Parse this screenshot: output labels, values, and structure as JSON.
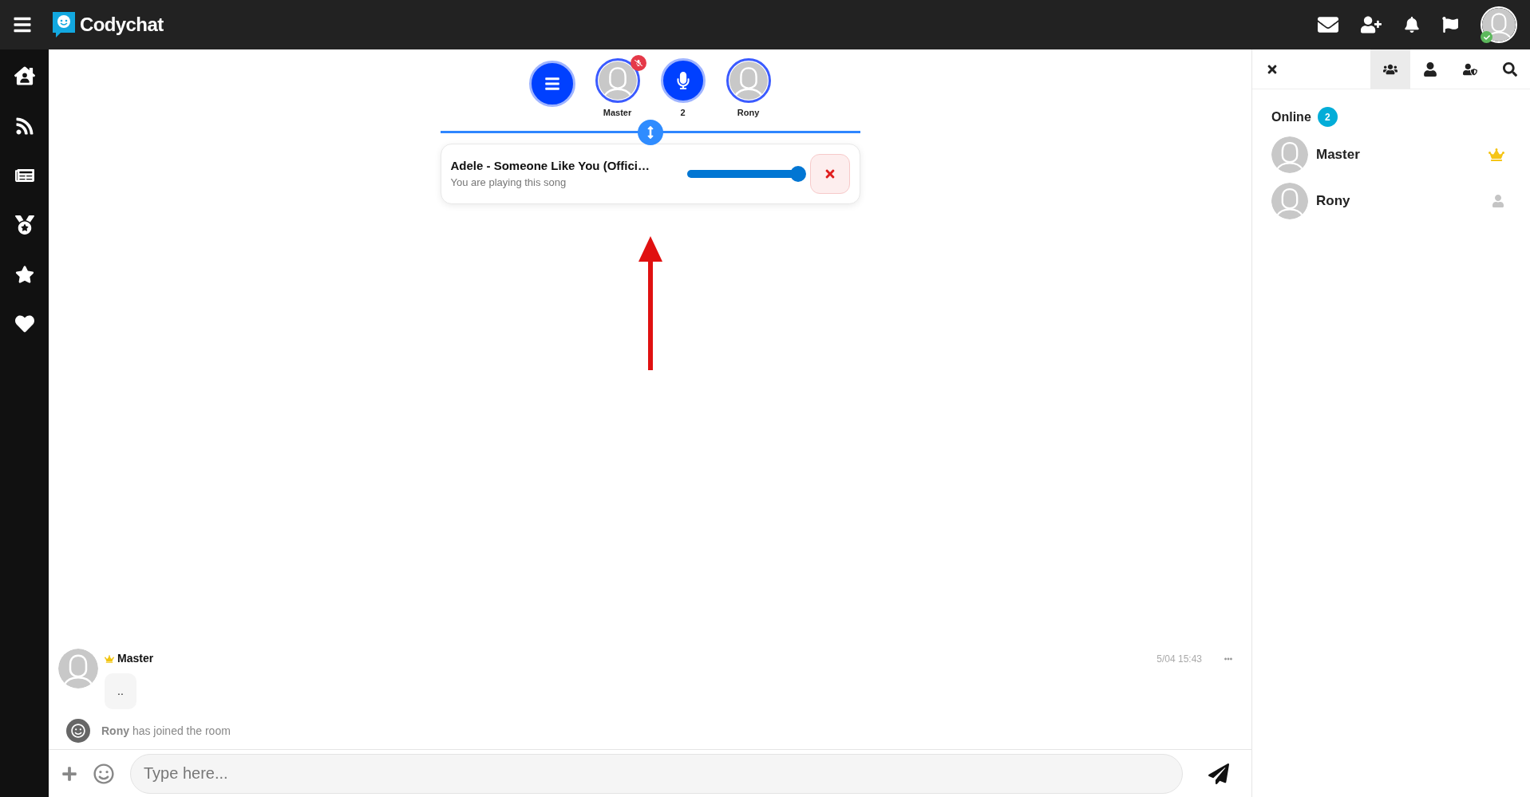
{
  "topbar": {
    "logo": "Codychat",
    "online": true
  },
  "stage": {
    "speakers": [
      {
        "kind": "avatar",
        "name": "Master",
        "muted": true
      },
      {
        "kind": "mic",
        "name": "2",
        "muted": false
      },
      {
        "kind": "avatar",
        "name": "Rony",
        "muted": false
      }
    ]
  },
  "player": {
    "title": "Adele - Someone Like You (Offici…",
    "subtitle": "You are playing this song",
    "level": 1.0
  },
  "messages": [
    {
      "kind": "post",
      "author": "Master",
      "crown": true,
      "text": "..",
      "time": "5/04 15:43"
    },
    {
      "kind": "system",
      "text": "**Rony** has joined the room"
    }
  ],
  "composer": {
    "placeholder": "Type here..."
  },
  "panel": {
    "tabs": [
      {
        "kind": "users",
        "selected": true
      },
      {
        "kind": "user",
        "selected": false
      },
      {
        "kind": "staff",
        "selected": false
      },
      {
        "kind": "search",
        "selected": false
      }
    ],
    "heading": "Online",
    "count": "2",
    "users": [
      {
        "name": "Master",
        "kind": "owner"
      },
      {
        "name": "Rony",
        "kind": "user"
      }
    ]
  }
}
